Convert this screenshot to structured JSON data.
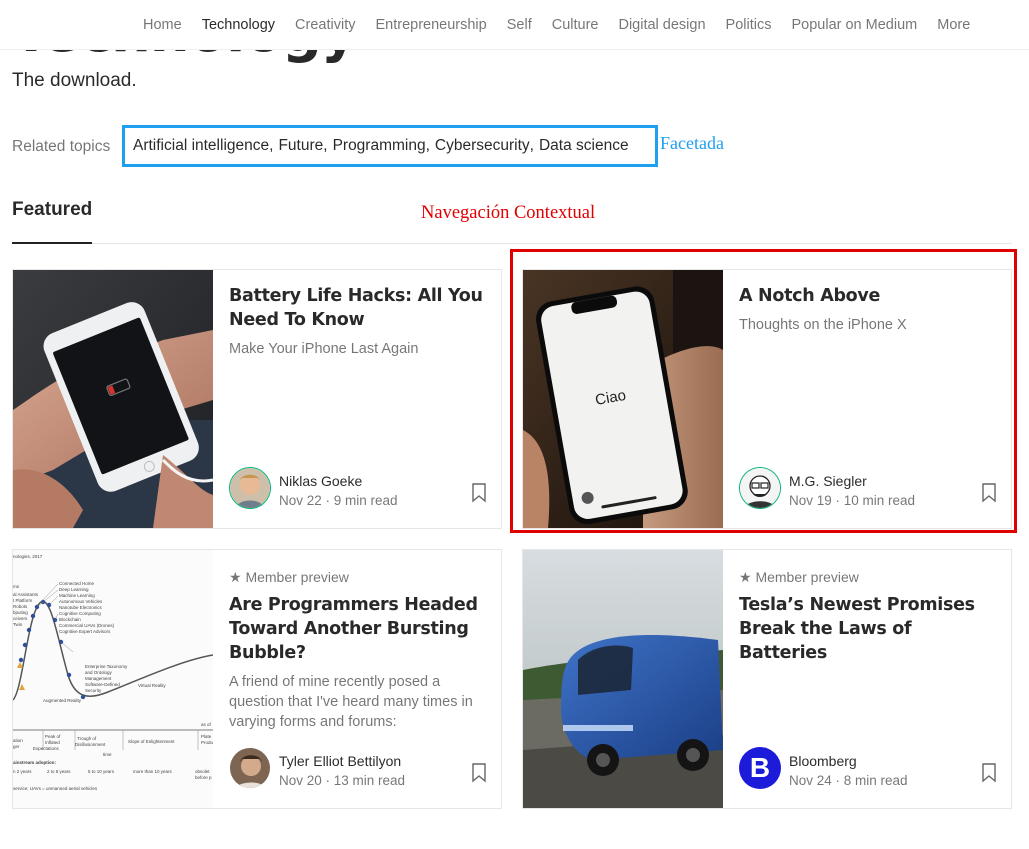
{
  "nav": {
    "items": [
      "Home",
      "Technology",
      "Creativity",
      "Entrepreneurship",
      "Self",
      "Culture",
      "Digital design",
      "Politics",
      "Popular on Medium",
      "More"
    ],
    "active": "Technology"
  },
  "topic": {
    "title": "Technology",
    "tagline": "The download."
  },
  "related": {
    "label": "Related topics",
    "topics": [
      "Artificial intelligence",
      "Future",
      "Programming",
      "Cybersecurity",
      "Data science"
    ],
    "separator": ","
  },
  "annotations": {
    "facet": "Facetada",
    "contextual": "Navegación Contextual",
    "facet_color": "#1e9ff0",
    "contextual_color": "#e00000"
  },
  "featured": {
    "tab_label": "Featured"
  },
  "articles": [
    {
      "title": "Battery Life Hacks: All You Need To Know",
      "subtitle": "Make Your iPhone Last Again",
      "badge": "",
      "author": "Niklas Goeke",
      "meta": "Nov 22 · 9 min read",
      "thumb": "phone-battery-photo",
      "avatar": "niklas-avatar"
    },
    {
      "title": "A Notch Above",
      "subtitle": "Thoughts on the iPhone X",
      "badge": "",
      "author": "M.G. Siegler",
      "meta": "Nov 19 · 10 min read",
      "thumb": "iphone-x-photo",
      "thumb_text": "Ciao",
      "avatar": "siegler-avatar"
    },
    {
      "title": "Are Programmers Headed Toward Another Bursting Bubble?",
      "subtitle": "A friend of mine recently posed a question that I've heard many times in varying forms and forums:",
      "badge": "★ Member preview",
      "author": "Tyler Elliot Bettilyon",
      "meta": "Nov 20 · 13 min read",
      "thumb": "hype-cycle-chart",
      "avatar": "tyler-avatar"
    },
    {
      "title": "Tesla’s Newest Promises Break the Laws of Batteries",
      "subtitle": "",
      "badge": "★ Member preview",
      "author": "Bloomberg",
      "meta": "Nov 24 · 8 min read",
      "thumb": "tesla-semi-photo",
      "avatar": "bloomberg-logo",
      "avatar_letter": "B"
    }
  ]
}
